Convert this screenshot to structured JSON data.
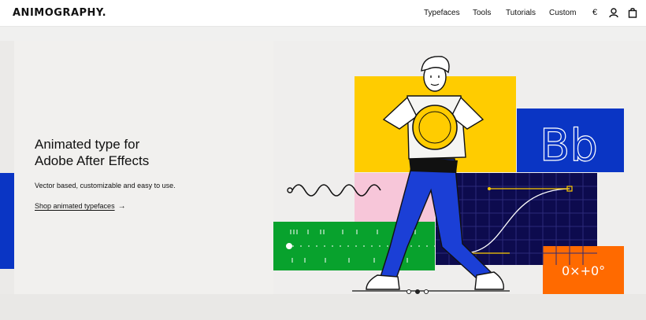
{
  "header": {
    "logo": "ANIMOGRAPHY.",
    "nav": [
      "Typefaces",
      "Tools",
      "Tutorials",
      "Custom"
    ],
    "currency": "€",
    "icons": [
      "currency-icon",
      "user-icon",
      "cart-icon"
    ]
  },
  "hero": {
    "headline_line1": "Animated type for",
    "headline_line2": "Adobe After Effects",
    "subtitle": "Vector based, customizable and easy to use.",
    "cta": "Shop animated typefaces",
    "cta_arrow": "→",
    "tile_bb": "Bb",
    "tile_expr": "0×+0°"
  },
  "carousel": {
    "count": 3,
    "active_index": 1
  },
  "colors": {
    "yellow": "#ffcc00",
    "blue": "#0a35c4",
    "navy": "#0d0b4e",
    "green": "#08a22d",
    "pink": "#f7c6d9",
    "orange": "#ff6a00"
  }
}
